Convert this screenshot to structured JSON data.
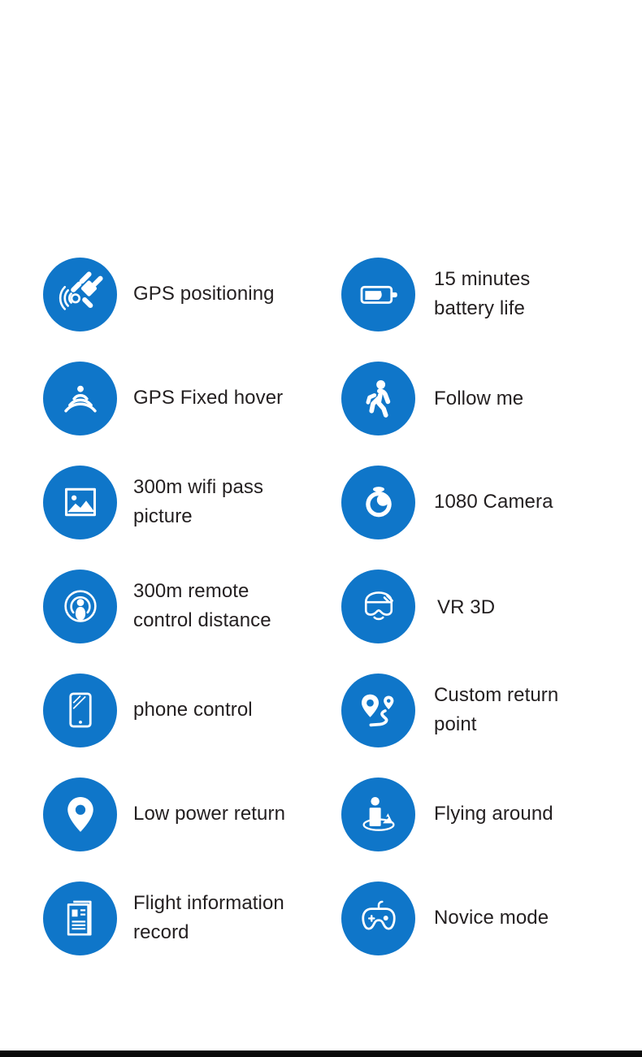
{
  "page": {
    "background_color": "#ffffff",
    "accent_color": "#0f76c9",
    "text_color": "#231f20",
    "bottom_bar_color": "#0a0a0a"
  },
  "features": [
    {
      "icon": "satellite-gps-icon",
      "label": "GPS positioning",
      "column": "left"
    },
    {
      "icon": "battery-icon",
      "label": "15 minutes\nbattery life",
      "column": "right"
    },
    {
      "icon": "gps-hover-signal-icon",
      "label": "GPS Fixed hover",
      "column": "left"
    },
    {
      "icon": "walking-person-icon",
      "label": "Follow me",
      "column": "right"
    },
    {
      "icon": "picture-image-icon",
      "label": "300m wifi pass\npicture",
      "column": "left"
    },
    {
      "icon": "camera-lens-icon",
      "label": "1080 Camera",
      "column": "right"
    },
    {
      "icon": "remote-signal-icon",
      "label": "300m remote\ncontrol distance",
      "column": "left"
    },
    {
      "icon": "vr-headset-icon",
      "label": "VR 3D",
      "column": "right"
    },
    {
      "icon": "smartphone-icon",
      "label": "phone control",
      "column": "left"
    },
    {
      "icon": "map-pins-route-icon",
      "label": "Custom return point",
      "column": "right"
    },
    {
      "icon": "location-pin-icon",
      "label": "Low power return",
      "column": "left"
    },
    {
      "icon": "orbit-person-icon",
      "label": "Flying around",
      "column": "right"
    },
    {
      "icon": "document-record-icon",
      "label": "Flight information\nrecord",
      "column": "left"
    },
    {
      "icon": "gamepad-icon",
      "label": "Novice mode",
      "column": "right"
    }
  ]
}
